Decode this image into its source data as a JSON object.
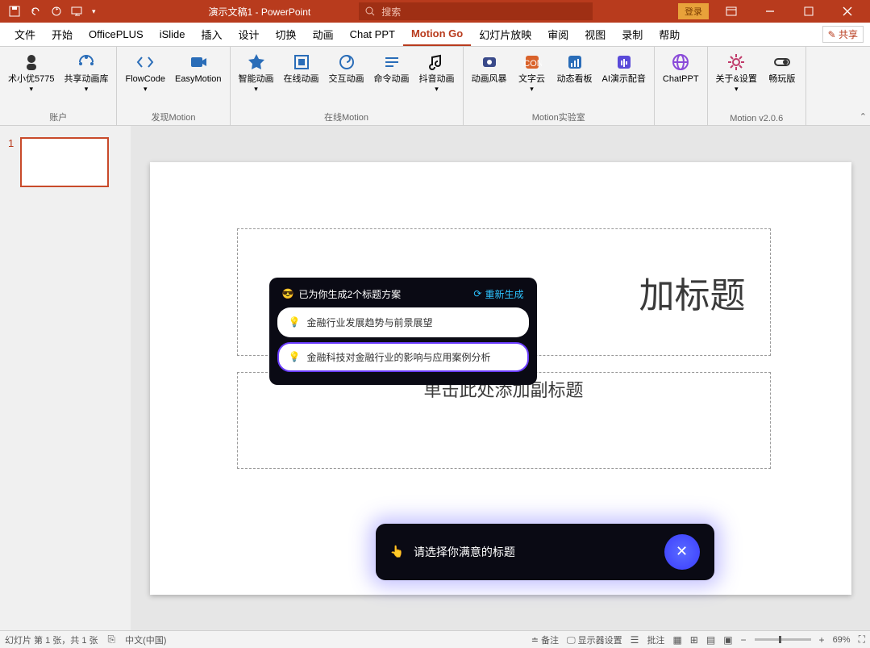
{
  "titlebar": {
    "title": "演示文稿1 - PowerPoint",
    "search_placeholder": "搜索",
    "login": "登录"
  },
  "menu": {
    "items": [
      "文件",
      "开始",
      "OfficePLUS",
      "iSlide",
      "插入",
      "设计",
      "切换",
      "动画",
      "Chat PPT",
      "Motion Go",
      "幻灯片放映",
      "审阅",
      "视图",
      "录制",
      "帮助"
    ],
    "active_index": 9,
    "share": "共享"
  },
  "ribbon": {
    "groups": [
      {
        "label": "账户",
        "items": [
          {
            "label": "术小优5775",
            "icon": "avatar",
            "dropdown": true
          },
          {
            "label": "共享动画库",
            "icon": "share",
            "dropdown": true
          }
        ]
      },
      {
        "label": "发现Motion",
        "items": [
          {
            "label": "FlowCode",
            "icon": "code",
            "dropdown": true
          },
          {
            "label": "EasyMotion",
            "icon": "video",
            "dropdown": false
          }
        ]
      },
      {
        "label": "在线Motion",
        "items": [
          {
            "label": "智能动画",
            "icon": "star",
            "dropdown": true
          },
          {
            "label": "在线动画",
            "icon": "frame",
            "dropdown": false
          },
          {
            "label": "交互动画",
            "icon": "spiral",
            "dropdown": false
          },
          {
            "label": "命令动画",
            "icon": "lines",
            "dropdown": false
          },
          {
            "label": "抖音动画",
            "icon": "music",
            "dropdown": true
          }
        ]
      },
      {
        "label": "Motion实验室",
        "items": [
          {
            "label": "动画风暴",
            "icon": "cloud",
            "dropdown": false
          },
          {
            "label": "文字云",
            "icon": "text",
            "dropdown": true
          },
          {
            "label": "动态看板",
            "icon": "chart",
            "dropdown": false
          },
          {
            "label": "AI演示配音",
            "icon": "audio",
            "dropdown": false
          }
        ]
      },
      {
        "label": "",
        "items": [
          {
            "label": "ChatPPT",
            "icon": "globe",
            "dropdown": false
          }
        ]
      },
      {
        "label": "Motion v2.0.6",
        "items": [
          {
            "label": "关于&设置",
            "icon": "gear",
            "dropdown": true
          },
          {
            "label": "畅玩版",
            "icon": "toggle",
            "dropdown": false
          }
        ]
      }
    ]
  },
  "thumbnails": {
    "current": "1"
  },
  "slide": {
    "title_placeholder": "加标题",
    "subtitle_placeholder": "单击此处添加副标题"
  },
  "ai_popup": {
    "header": "已为你生成2个标题方案",
    "regen": "重新生成",
    "options": [
      "金融行业发展趋势与前景展望",
      "金融科技对金融行业的影响与应用案例分析"
    ]
  },
  "bottom_prompt": {
    "text": "请选择你满意的标题"
  },
  "statusbar": {
    "slide_info": "幻灯片 第 1 张，共 1 张",
    "language": "中文(中国)",
    "notes": "备注",
    "display": "显示器设置",
    "comments": "批注",
    "zoom": "69%"
  },
  "colors": {
    "accent": "#b83b1d",
    "ai_blue": "#2dc3ff",
    "ai_purple": "#6a3cff"
  }
}
